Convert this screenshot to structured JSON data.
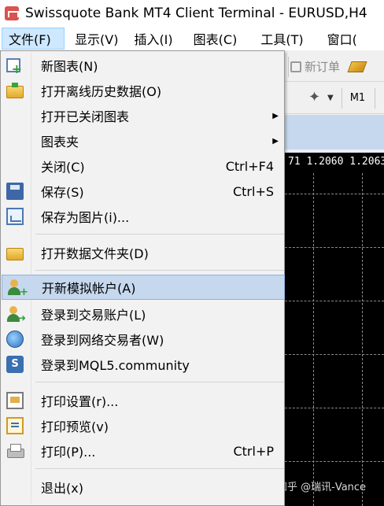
{
  "window": {
    "title": "Swissquote Bank MT4 Client Terminal - EURUSD,H4"
  },
  "menubar": {
    "items": [
      {
        "label": "文件(F)"
      },
      {
        "label": "显示(V)"
      },
      {
        "label": "插入(I)"
      },
      {
        "label": "图表(C)"
      },
      {
        "label": "工具(T)"
      },
      {
        "label": "窗口("
      }
    ]
  },
  "toolbar": {
    "new_order_label": "新订单",
    "timeframe_m1": "M1"
  },
  "chart": {
    "price_label": "71 1.2060 1.2063"
  },
  "file_menu": {
    "items": [
      {
        "label": "新图表(N)",
        "icon": "new-chart-icon"
      },
      {
        "label": "打开离线历史数据(O)",
        "icon": "open-folder-icon"
      },
      {
        "label": "打开已关闭图表",
        "icon": "",
        "submenu": true
      },
      {
        "label": "图表夹",
        "icon": "",
        "submenu": true
      },
      {
        "label": "关闭(C)",
        "icon": "",
        "shortcut": "Ctrl+F4"
      },
      {
        "label": "保存(S)",
        "icon": "save-icon",
        "shortcut": "Ctrl+S"
      },
      {
        "label": "保存为图片(i)...",
        "icon": "save-image-icon"
      },
      {
        "label": "打开数据文件夹(D)",
        "icon": "folder-icon"
      },
      {
        "label": "开新模拟帐户(A)",
        "icon": "new-account-icon",
        "highlighted": true
      },
      {
        "label": "登录到交易账户(L)",
        "icon": "login-account-icon"
      },
      {
        "label": "登录到网络交易者(W)",
        "icon": "web-trader-icon"
      },
      {
        "label": "登录到MQL5.community",
        "icon": "mql5-icon"
      },
      {
        "label": "打印设置(r)...",
        "icon": "print-setup-icon"
      },
      {
        "label": "打印预览(v)",
        "icon": "print-preview-icon"
      },
      {
        "label": "打印(P)...",
        "icon": "printer-icon",
        "shortcut": "Ctrl+P"
      },
      {
        "label": "退出(x)",
        "icon": ""
      }
    ]
  },
  "watermark": "知乎 @瑞讯-Vance",
  "colors": {
    "menu_highlight": "#c6d8ee",
    "menubar_active": "#cde8ff",
    "chart_background": "#000000"
  }
}
